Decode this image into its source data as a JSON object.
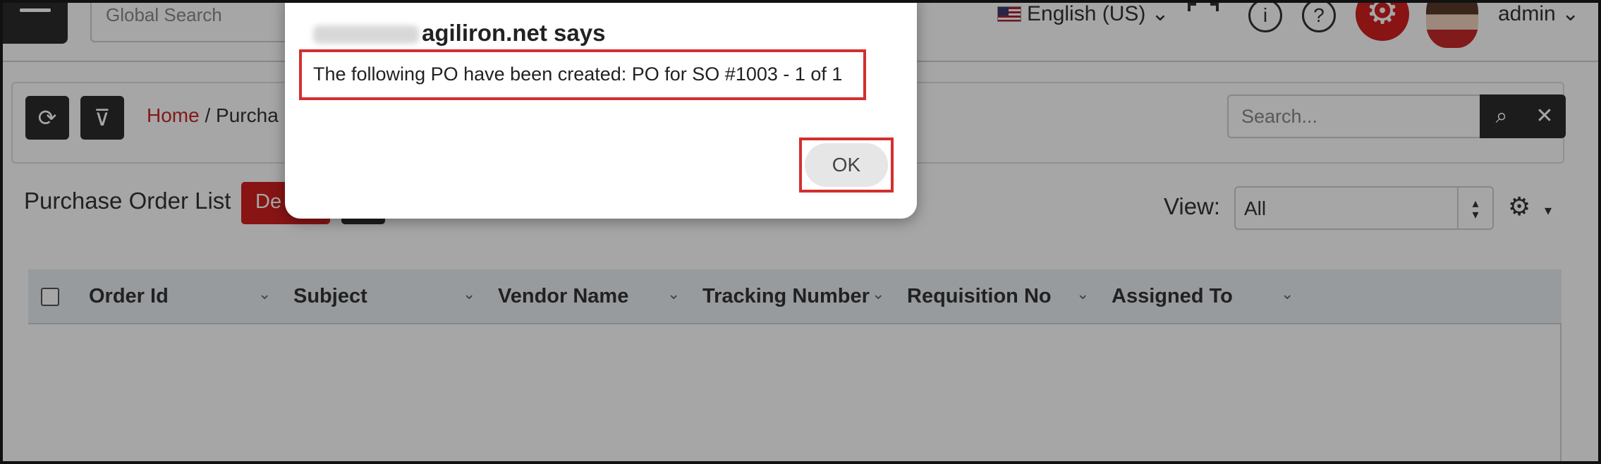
{
  "topbar": {
    "global_search_placeholder": "Global Search",
    "language": "English (US)",
    "language_caret": "⌄",
    "info_icon": "i",
    "help_icon": "?",
    "user_name": "admin",
    "user_caret": "⌄"
  },
  "toolbar": {
    "refresh_icon": "⟳",
    "filter_icon": "⊽",
    "breadcrumb_home": "Home",
    "breadcrumb_sep": "/",
    "breadcrumb_current": "Purcha",
    "search_placeholder": "Search...",
    "search_icon": "⌕",
    "clear_icon": "✕"
  },
  "list": {
    "title": "Purchase Order List",
    "delete_label": "De",
    "view_label": "View:",
    "view_value": "All",
    "view_arrows_up": "▴",
    "view_arrows_down": "▾",
    "settings_icon": "⚙",
    "settings_caret": "▾"
  },
  "grid": {
    "columns": [
      {
        "label": "Order Id",
        "caret": "⌄"
      },
      {
        "label": "Subject",
        "caret": "⌄"
      },
      {
        "label": "Vendor Name",
        "caret": "⌄"
      },
      {
        "label": "Tracking Number",
        "caret": "⌄"
      },
      {
        "label": "Requisition No",
        "caret": "⌄"
      },
      {
        "label": "Assigned To",
        "caret": "⌄"
      }
    ]
  },
  "dialog": {
    "title_suffix": "agiliron.net says",
    "message": "The following PO have been created: PO for SO #1003 - 1 of 1",
    "ok_label": "OK"
  },
  "colors": {
    "accent_red": "#d11f1f",
    "highlight_red": "#d32f2f",
    "dark_button": "#2b2b2b"
  }
}
